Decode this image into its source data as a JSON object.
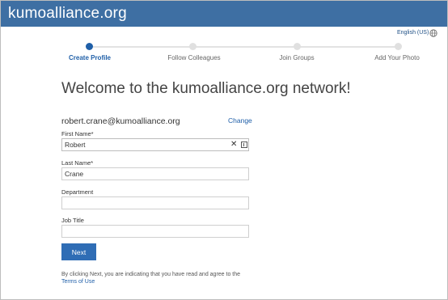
{
  "header": {
    "brand": "kumoalliance.org"
  },
  "language": {
    "label": "English (US)",
    "icon": "globe-icon"
  },
  "steps": [
    {
      "label": "Create Profile",
      "active": true
    },
    {
      "label": "Follow Colleagues",
      "active": false
    },
    {
      "label": "Join Groups",
      "active": false
    },
    {
      "label": "Add Your Photo",
      "active": false
    }
  ],
  "welcome": "Welcome to the kumoalliance.org network!",
  "account": {
    "email": "robert.crane@kumoalliance.org",
    "change_label": "Change"
  },
  "form": {
    "first_name": {
      "label": "First Name*",
      "value": "Robert"
    },
    "last_name": {
      "label": "Last Name*",
      "value": "Crane"
    },
    "department": {
      "label": "Department",
      "value": ""
    },
    "job_title": {
      "label": "Job Title",
      "value": ""
    },
    "clear_glyph": "✕",
    "next_label": "Next"
  },
  "terms": {
    "text": "By clicking Next, you are indicating that you have read and agree to the",
    "link": "Terms of Use"
  },
  "colors": {
    "header": "#3e6fa3",
    "accent": "#1f5fa8",
    "button": "#2f6db5"
  }
}
